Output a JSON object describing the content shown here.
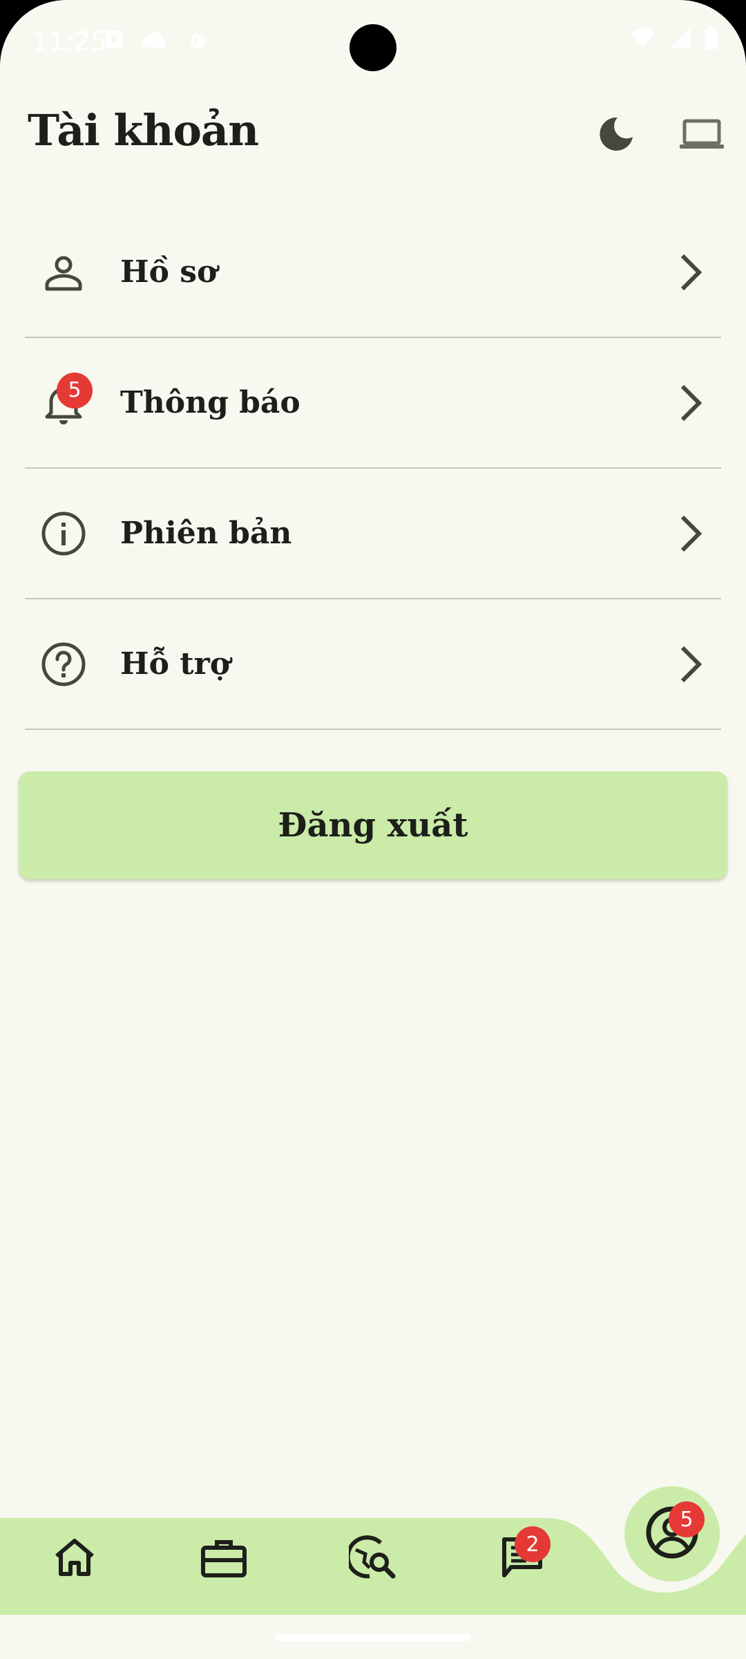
{
  "status_bar": {
    "time": "11:25",
    "left_icons": [
      "notification-square-icon",
      "cloud-icon",
      "google-icon"
    ],
    "right_icons": [
      "wifi-icon",
      "cell-signal-icon",
      "battery-icon"
    ]
  },
  "header": {
    "title": "Tài khoản",
    "actions": [
      "dark-mode-moon-icon",
      "laptop-icon"
    ]
  },
  "menu": {
    "items": [
      {
        "label": "Hồ sơ",
        "icon": "person-icon"
      },
      {
        "label": "Thông báo",
        "icon": "bell-icon",
        "badge": "5"
      },
      {
        "label": "Phiên bản",
        "icon": "info-icon"
      },
      {
        "label": "Hỗ trợ",
        "icon": "help-icon"
      }
    ]
  },
  "logout": {
    "label": "Đăng xuất"
  },
  "bottom_nav": {
    "items": [
      {
        "icon": "home-icon"
      },
      {
        "icon": "briefcase-icon"
      },
      {
        "icon": "travel-explore-icon"
      },
      {
        "icon": "chat-icon",
        "badge": "2"
      },
      {
        "icon": "account-circle-icon",
        "badge": "5",
        "active": true
      }
    ]
  },
  "colors": {
    "background": "#f7f8f0",
    "accent": "#cbeba8",
    "badge": "#e53935",
    "text": "#1d1f1a",
    "icon": "#44483f"
  }
}
